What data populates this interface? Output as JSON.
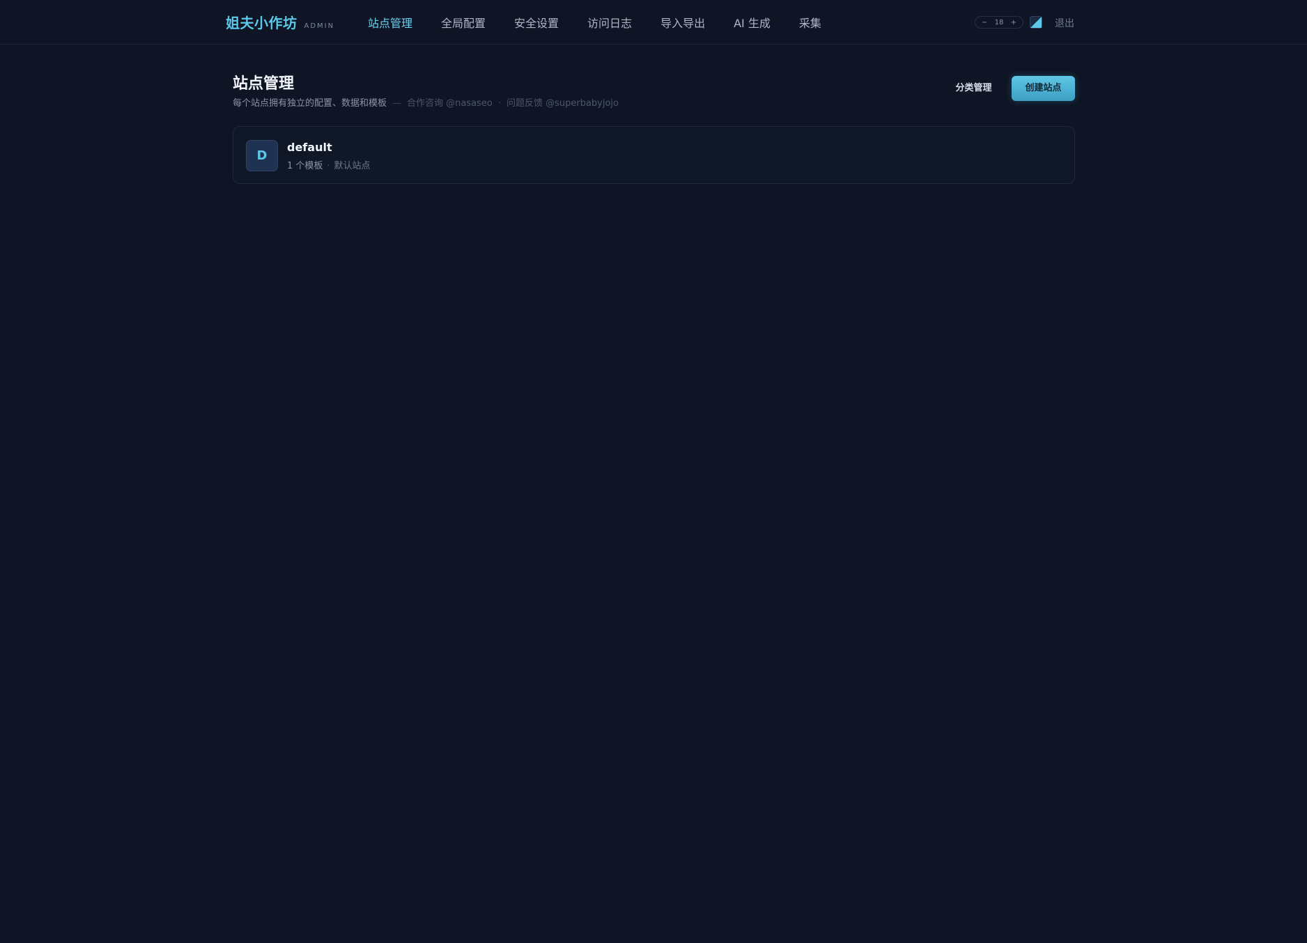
{
  "brand": {
    "name": "姐夫小作坊",
    "tag": "ADMIN"
  },
  "nav": {
    "items": [
      {
        "label": "站点管理",
        "active": true
      },
      {
        "label": "全局配置",
        "active": false
      },
      {
        "label": "安全设置",
        "active": false
      },
      {
        "label": "访问日志",
        "active": false
      },
      {
        "label": "导入导出",
        "active": false
      },
      {
        "label": "AI 生成",
        "active": false
      },
      {
        "label": "采集",
        "active": false
      }
    ]
  },
  "toolbar": {
    "zoom_minus": "−",
    "zoom_value": "18",
    "zoom_plus": "+",
    "theme_icon": "contrast-icon",
    "logout_label": "退出"
  },
  "page": {
    "title": "站点管理",
    "description": "每个站点拥有独立的配置、数据和模板",
    "separator": "—",
    "contact": "合作咨询 @nasaseo",
    "dot": "·",
    "feedback": "问题反馈 @superbabyjojo",
    "category_button": "分类管理",
    "create_button": "创建站点"
  },
  "sites": [
    {
      "avatar_letter": "D",
      "name": "default",
      "template_count": "1 个模板",
      "dot": "·",
      "badge": "默认站点"
    }
  ],
  "colors": {
    "background": "#0f1524",
    "accent": "#5cc8ea",
    "button_gradient_top": "#5ec6e6",
    "button_gradient_bottom": "#3d9fc2"
  }
}
